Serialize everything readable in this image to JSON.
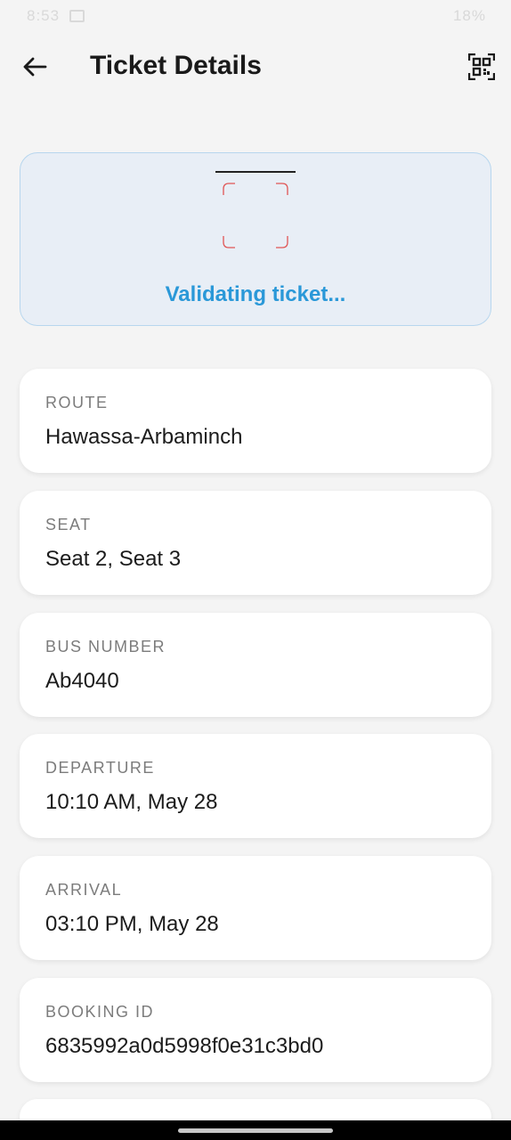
{
  "status_bar": {
    "time": "8:53",
    "right": "18%"
  },
  "header": {
    "title": "Ticket Details"
  },
  "validation": {
    "message": "Validating ticket..."
  },
  "details": [
    {
      "label": "ROUTE",
      "value": "Hawassa-Arbaminch"
    },
    {
      "label": "SEAT",
      "value": "Seat 2, Seat 3"
    },
    {
      "label": "BUS NUMBER",
      "value": "Ab4040"
    },
    {
      "label": "DEPARTURE",
      "value": "10:10 AM, May 28"
    },
    {
      "label": "ARRIVAL",
      "value": "03:10 PM, May 28"
    },
    {
      "label": "BOOKING ID",
      "value": "6835992a0d5998f0e31c3bd0"
    }
  ],
  "icons": {
    "back": "arrow-left-icon",
    "qr": "qr-code-scan-icon",
    "scan_frame": "scan-frame-icon",
    "status_image": "image-icon"
  },
  "colors": {
    "accent": "#2a98d8",
    "validation_bg": "#e8eef6",
    "validation_border": "#b7d6ee",
    "scan_corner": "#e05555"
  }
}
